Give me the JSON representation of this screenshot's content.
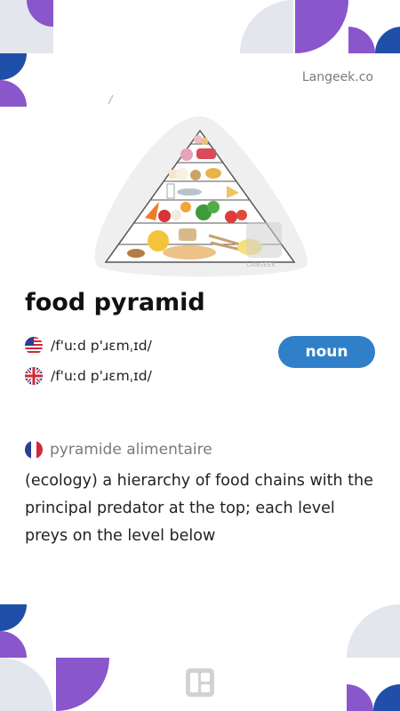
{
  "brand": "Langeek.co",
  "word": "food pyramid",
  "pronunciations": [
    {
      "flag_icon": "us-flag-icon",
      "ipa": "/f'uːd p'ɹɛmˌɪd/"
    },
    {
      "flag_icon": "uk-flag-icon",
      "ipa": "/f'uːd p'ɹɛmˌɪd/"
    }
  ],
  "part_of_speech": "noun",
  "translation": {
    "flag_icon": "fr-flag-icon",
    "text": "pyramide alimentaire"
  },
  "definition": "(ecology) a hierarchy of food chains with the principal predator at the top; each level preys on the level below",
  "colors": {
    "purple": "#8a56cc",
    "blue": "#1f4fa8",
    "light": "#e4e6ee",
    "accent": "#2f80c8"
  }
}
